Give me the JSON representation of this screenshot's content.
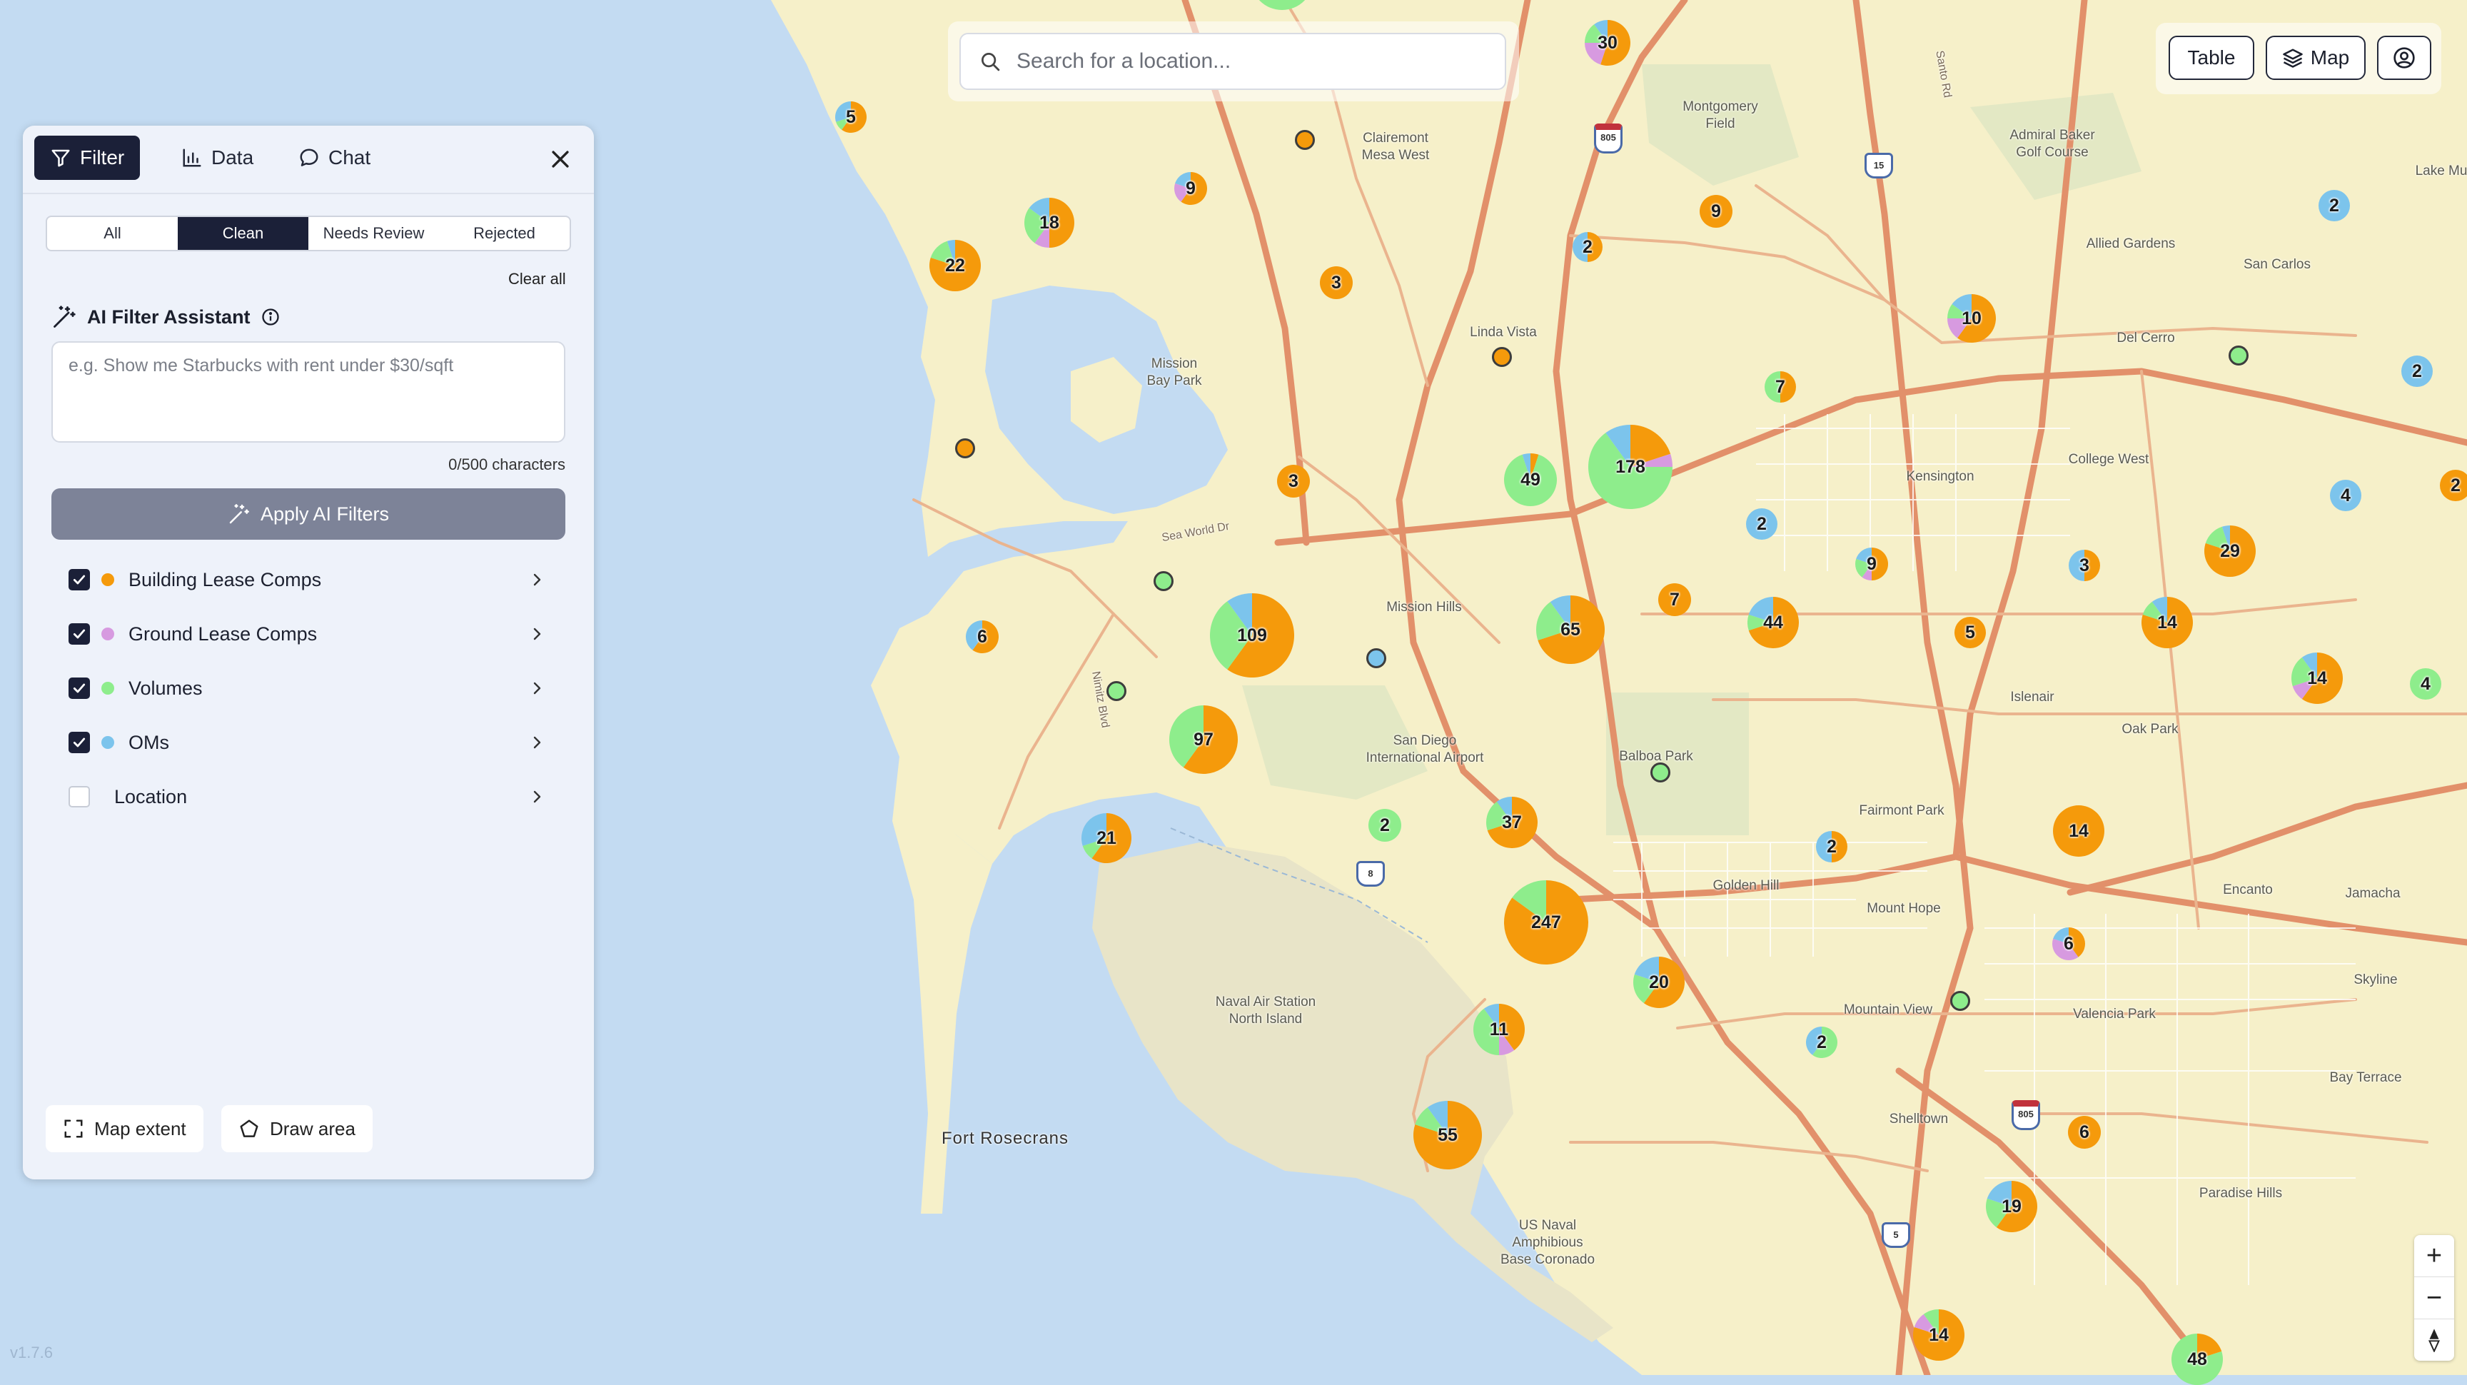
{
  "search": {
    "placeholder": "Search for a location..."
  },
  "topbar": {
    "table_label": "Table",
    "map_label": "Map"
  },
  "panel": {
    "tabs": [
      {
        "label": "Filter"
      },
      {
        "label": "Data"
      },
      {
        "label": "Chat"
      }
    ],
    "segments": [
      "All",
      "Clean",
      "Needs Review",
      "Rejected"
    ],
    "active_segment": "Clean",
    "clear_all": "Clear all",
    "ai_title": "AI Filter Assistant",
    "ai_placeholder": "e.g. Show me Starbucks with rent under $30/sqft",
    "char_count": "0/500 characters",
    "apply_label": "Apply AI Filters",
    "layers": [
      {
        "label": "Building Lease Comps",
        "checked": true,
        "color": "#f59a0b"
      },
      {
        "label": "Ground Lease Comps",
        "checked": true,
        "color": "#d79ae0"
      },
      {
        "label": "Volumes",
        "checked": true,
        "color": "#8eed8c"
      },
      {
        "label": "OMs",
        "checked": true,
        "color": "#7cc4ec"
      },
      {
        "label": "Location",
        "checked": false,
        "color": ""
      }
    ],
    "map_extent_label": "Map extent",
    "draw_area_label": "Draw area"
  },
  "version": "v1.7.6",
  "colors": {
    "building": "#f59a0b",
    "ground": "#d79ae0",
    "volumes": "#8eed8c",
    "oms": "#7cc4ec",
    "land": "#f6f0c9",
    "water": "#c3dbf2",
    "road": "#e2906a",
    "dark": "#1b2038"
  },
  "map_labels": [
    {
      "text": "Montgomery\nField"
    },
    {
      "text": "Clairemont\nMesa West"
    },
    {
      "text": "Admiral Baker\nGolf Course"
    },
    {
      "text": "Lake Mu"
    },
    {
      "text": "Allied Gardens"
    },
    {
      "text": "San Carlos"
    },
    {
      "text": "Del Cerro"
    },
    {
      "text": "Linda Vista"
    },
    {
      "text": "Mission\nBay Park"
    },
    {
      "text": "Kensington"
    },
    {
      "text": "College West"
    },
    {
      "text": "Sea World Dr"
    },
    {
      "text": "Mission Hills"
    },
    {
      "text": "Nimitz Blvd"
    },
    {
      "text": "San Diego\nInternational Airport"
    },
    {
      "text": "Balboa Park"
    },
    {
      "text": "Islenair"
    },
    {
      "text": "Oak Park"
    },
    {
      "text": "Fairmont Park"
    },
    {
      "text": "Golden Hill"
    },
    {
      "text": "Mount Hope"
    },
    {
      "text": "Encanto"
    },
    {
      "text": "Jamacha"
    },
    {
      "text": "Naval Air Station\nNorth Island"
    },
    {
      "text": "Mountain View"
    },
    {
      "text": "Valencia Park"
    },
    {
      "text": "Skyline"
    },
    {
      "text": "Bay Terrace"
    },
    {
      "text": "Shelltown"
    },
    {
      "text": "Fort Rosecrans"
    },
    {
      "text": "US Naval\nAmphibious\nBase Coronado"
    },
    {
      "text": "Paradise Hills"
    },
    {
      "text": "Santo Rd"
    }
  ],
  "shields": [
    "805",
    "15",
    "8",
    "5",
    "805"
  ],
  "clusters": [
    {
      "count": "30",
      "mix": [
        0.55,
        0.2,
        0.15,
        0.1
      ]
    },
    {
      "count": "5",
      "mix": [
        0.6,
        0,
        0.1,
        0.3
      ]
    },
    {
      "count": "9",
      "mix": [
        0.6,
        0.2,
        0,
        0.2
      ]
    },
    {
      "count": "18",
      "mix": [
        0.5,
        0.1,
        0.25,
        0.15
      ]
    },
    {
      "count": "22",
      "mix": [
        0.8,
        0,
        0.15,
        0.05
      ]
    },
    {
      "count": "3",
      "mix": [
        1,
        0,
        0,
        0
      ]
    },
    {
      "count": "9",
      "mix": [
        1,
        0,
        0,
        0
      ]
    },
    {
      "count": "2",
      "mix": [
        0.5,
        0,
        0,
        0.5
      ]
    },
    {
      "count": "10",
      "mix": [
        0.6,
        0.15,
        0.1,
        0.15
      ]
    },
    {
      "count": "7",
      "mix": [
        0.5,
        0,
        0.5,
        0
      ]
    },
    {
      "count": "178",
      "mix": [
        0.2,
        0.05,
        0.65,
        0.1
      ]
    },
    {
      "count": "49",
      "mix": [
        0.05,
        0,
        0.9,
        0.05
      ]
    },
    {
      "count": "3",
      "mix": [
        1,
        0,
        0,
        0
      ]
    },
    {
      "count": "2",
      "mix": [
        0,
        0,
        0,
        1
      ]
    },
    {
      "count": "9",
      "mix": [
        0.5,
        0.1,
        0.2,
        0.2
      ]
    },
    {
      "count": "2",
      "mix": [
        0,
        0,
        0,
        1
      ]
    },
    {
      "count": "29",
      "mix": [
        0.8,
        0,
        0.15,
        0.05
      ]
    },
    {
      "count": "4",
      "mix": [
        0,
        0,
        0,
        1
      ]
    },
    {
      "count": "109",
      "mix": [
        0.6,
        0,
        0.3,
        0.1
      ]
    },
    {
      "count": "65",
      "mix": [
        0.7,
        0,
        0.2,
        0.1
      ]
    },
    {
      "count": "7",
      "mix": [
        1,
        0,
        0,
        0
      ]
    },
    {
      "count": "44",
      "mix": [
        0.7,
        0,
        0.1,
        0.2
      ]
    },
    {
      "count": "3",
      "mix": [
        0.5,
        0,
        0,
        0.5
      ]
    },
    {
      "count": "14",
      "mix": [
        0.8,
        0,
        0.1,
        0.1
      ]
    },
    {
      "count": "5",
      "mix": [
        1,
        0,
        0,
        0
      ]
    },
    {
      "count": "14",
      "mix": [
        0.6,
        0.1,
        0.2,
        0.1
      ]
    },
    {
      "count": "4",
      "mix": [
        0,
        0,
        1,
        0
      ]
    },
    {
      "count": "6",
      "mix": [
        0.6,
        0,
        0,
        0.4
      ]
    },
    {
      "count": "97",
      "mix": [
        0.6,
        0,
        0.4,
        0
      ]
    },
    {
      "count": "21",
      "mix": [
        0.6,
        0,
        0.1,
        0.3
      ]
    },
    {
      "count": "2",
      "mix": [
        0,
        0,
        1,
        0
      ]
    },
    {
      "count": "37",
      "mix": [
        0.7,
        0,
        0.2,
        0.1
      ]
    },
    {
      "count": "14",
      "mix": [
        1,
        0,
        0,
        0
      ]
    },
    {
      "count": "247",
      "mix": [
        0.85,
        0,
        0.15,
        0
      ]
    },
    {
      "count": "20",
      "mix": [
        0.6,
        0,
        0.2,
        0.2
      ]
    },
    {
      "count": "6",
      "mix": [
        0.4,
        0.4,
        0,
        0.2
      ]
    },
    {
      "count": "11",
      "mix": [
        0.4,
        0.1,
        0.4,
        0.1
      ]
    },
    {
      "count": "2",
      "mix": [
        0,
        0,
        0.6,
        0.4
      ]
    },
    {
      "count": "55",
      "mix": [
        0.8,
        0,
        0.1,
        0.1
      ]
    },
    {
      "count": "6",
      "mix": [
        1,
        0,
        0,
        0
      ]
    },
    {
      "count": "19",
      "mix": [
        0.6,
        0,
        0.2,
        0.2
      ]
    },
    {
      "count": "14",
      "mix": [
        0.8,
        0.1,
        0.1,
        0
      ]
    },
    {
      "count": "48",
      "mix": [
        0.2,
        0,
        0.8,
        0
      ]
    },
    {
      "count": "2",
      "mix": [
        0,
        0,
        0,
        1
      ]
    },
    {
      "count": "2",
      "mix": [
        0.5,
        0,
        0,
        0.5
      ]
    },
    {
      "count": "2",
      "mix": [
        1,
        0,
        0,
        0
      ]
    }
  ],
  "points": [
    {
      "color": "#f59a0b"
    },
    {
      "color": "#f59a0b"
    },
    {
      "color": "#f59a0b"
    },
    {
      "color": "#8eed8c"
    },
    {
      "color": "#8eed8c"
    },
    {
      "color": "#7cc4ec"
    },
    {
      "color": "#8eed8c"
    },
    {
      "color": "#8eed8c"
    },
    {
      "color": "#8eed8c"
    }
  ]
}
